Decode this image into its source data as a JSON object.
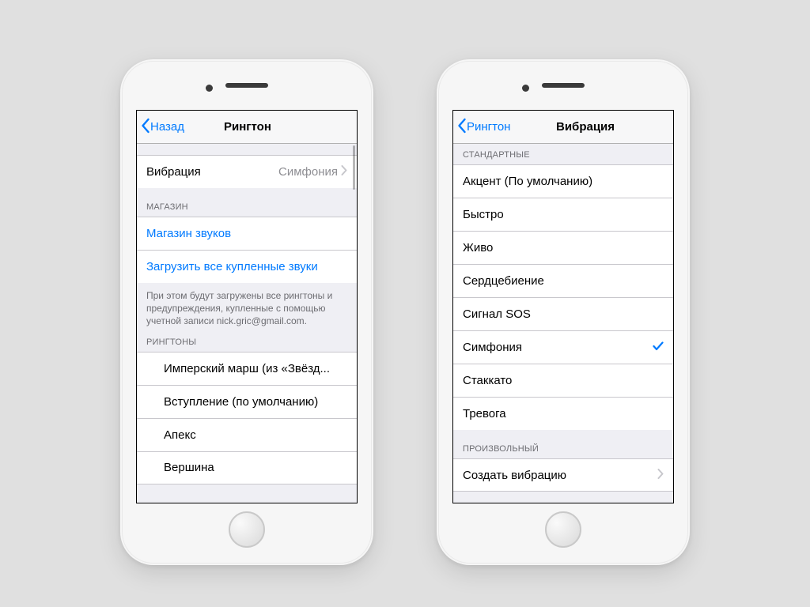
{
  "left": {
    "back_label": "Назад",
    "title": "Рингтон",
    "vibration": {
      "label": "Вибрация",
      "value": "Симфония"
    },
    "store_header": "МАГАЗИН",
    "store_sound": "Магазин звуков",
    "store_download": "Загрузить все купленные звуки",
    "store_note": "При этом будут загружены все рингтоны и предупреждения, купленные с помощью учетной записи nick.gric@gmail.com.",
    "ringtones_header": "РИНГТОНЫ",
    "ringtones": [
      "Имперский марш (из «Звёзд...",
      "Вступление (по умолчанию)",
      "Апекс",
      "Вершина"
    ]
  },
  "right": {
    "back_label": "Рингтон",
    "title": "Вибрация",
    "standard_header": "СТАНДАРТНЫЕ",
    "standard": [
      {
        "label": "Акцент (По умолчанию)",
        "checked": false
      },
      {
        "label": "Быстро",
        "checked": false
      },
      {
        "label": "Живо",
        "checked": false
      },
      {
        "label": "Сердцебиение",
        "checked": false
      },
      {
        "label": "Сигнал SOS",
        "checked": false
      },
      {
        "label": "Симфония",
        "checked": true
      },
      {
        "label": "Стаккато",
        "checked": false
      },
      {
        "label": "Тревога",
        "checked": false
      }
    ],
    "custom_header": "ПРОИЗВОЛЬНЫЙ",
    "custom_create": "Создать вибрацию"
  },
  "colors": {
    "ios_blue": "#007aff"
  }
}
